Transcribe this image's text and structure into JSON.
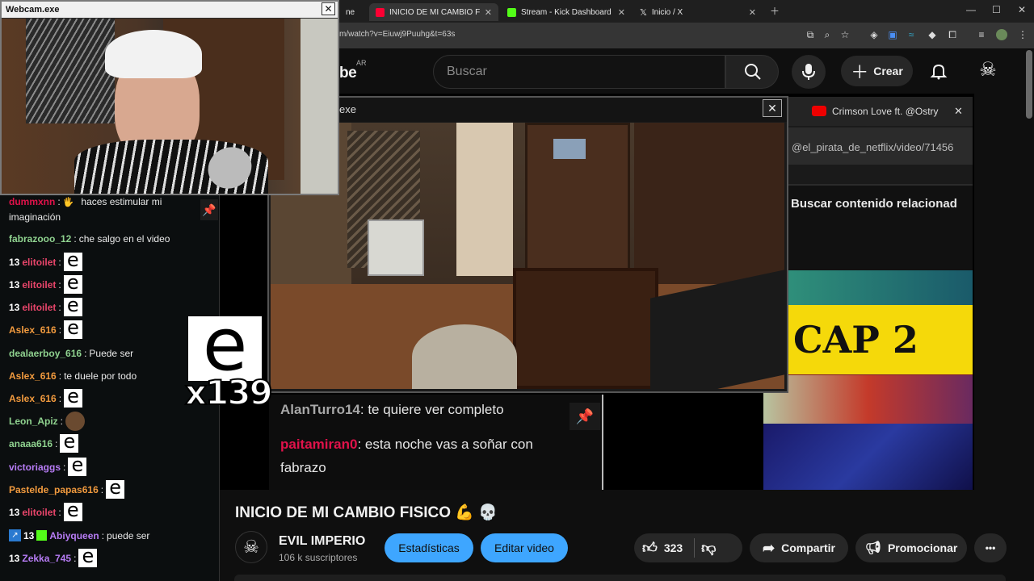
{
  "browser": {
    "tabs": [
      {
        "label": "INICIO DE MI CAMBIO FISICO 💪",
        "active": true,
        "icon": "youtube-icon"
      },
      {
        "label": "Stream - Kick Dashboard",
        "active": false,
        "icon": "kick-icon"
      },
      {
        "label": "Inicio / X",
        "active": false,
        "icon": "x-icon"
      }
    ],
    "partial_tab": "ne",
    "url": "m/watch?v=Eiuwj9Puuhg&t=63s",
    "window_controls": [
      "—",
      "☐",
      "✕"
    ]
  },
  "youtube": {
    "logo_partial": "be",
    "country": "AR",
    "search_placeholder": "Buscar",
    "create_label": "Crear",
    "video_title": "INICIO DE MI CAMBIO FISICO 💪 💀",
    "channel_name": "EVIL IMPERIO",
    "subscribers": "106 k suscriptores",
    "stats_button": "Estadísticas",
    "edit_button": "Editar video",
    "likes": "323",
    "share_label": "Compartir",
    "promote_label": "Promocionar",
    "more_label": "•••"
  },
  "popup": {
    "title_partial": "exe",
    "close": "✕",
    "chat": [
      {
        "user": "AlanTurro14",
        "text": ": te quiere ver completo"
      },
      {
        "user": "paitamiran0",
        "text": ": esta noche vas a soñar con"
      },
      {
        "user": "",
        "text": "fabrazo"
      }
    ]
  },
  "right_pane": {
    "tab_label": "Crimson Love ft. @Ostry",
    "tab_close": "✕",
    "url_text": "@el_pirata_de_netflix/video/71456",
    "search_text": "Buscar contenido relacionad",
    "thumb_text": "CAP 2"
  },
  "webcam": {
    "title": "Webcam.exe",
    "close": "✕"
  },
  "chat": {
    "pin_icon": "📌",
    "big_emote": "e",
    "combo": "x139",
    "messages": [
      {
        "badge": "",
        "user": "dummxnn",
        "color": "#e0124a",
        "text": "haces estimular mi",
        "emote": false
      },
      {
        "badge": "",
        "user": "",
        "color": "#eaeaea",
        "text": "imaginación",
        "emote": false
      },
      {
        "badge": "",
        "user": "fabrazooo_12",
        "color": "#8fd28f",
        "text": "che salgo en el video",
        "emote": false
      },
      {
        "badge": "13",
        "user": "elitoilet",
        "color": "#e8456a",
        "text": "",
        "emote": true
      },
      {
        "badge": "13",
        "user": "elitoilet",
        "color": "#e8456a",
        "text": "",
        "emote": true
      },
      {
        "badge": "13",
        "user": "elitoilet",
        "color": "#e8456a",
        "text": "",
        "emote": true
      },
      {
        "badge": "",
        "user": "Aslex_616",
        "color": "#f19a3e",
        "text": "",
        "emote": true
      },
      {
        "badge": "",
        "user": "dealaerboy_616",
        "color": "#8fd28f",
        "text": "Puede ser",
        "emote": false
      },
      {
        "badge": "",
        "user": "Aslex_616",
        "color": "#f19a3e",
        "text": "te duele por todo",
        "emote": false
      },
      {
        "badge": "",
        "user": "Aslex_616",
        "color": "#f19a3e",
        "text": "",
        "emote": true
      },
      {
        "badge": "",
        "user": "Leon_Apiz",
        "color": "#8fd28f",
        "text": "",
        "emote": false
      },
      {
        "badge": "",
        "user": "anaaa616",
        "color": "#8fd28f",
        "text": "",
        "emote": true
      },
      {
        "badge": "",
        "user": "victoriaggs",
        "color": "#b77cf5",
        "text": "",
        "emote": true
      },
      {
        "badge": "",
        "user": "Pastelde_papas616",
        "color": "#f19a3e",
        "text": "",
        "emote": true
      },
      {
        "badge": "13",
        "user": "elitoilet",
        "color": "#e8456a",
        "text": "",
        "emote": true
      },
      {
        "badge": "13",
        "user": "Abiyqueen",
        "color": "#b77cf5",
        "text": "puede ser",
        "emote": false
      },
      {
        "badge": "13",
        "user": "Zekka_745",
        "color": "#b77cf5",
        "text": "",
        "emote": true
      }
    ]
  }
}
